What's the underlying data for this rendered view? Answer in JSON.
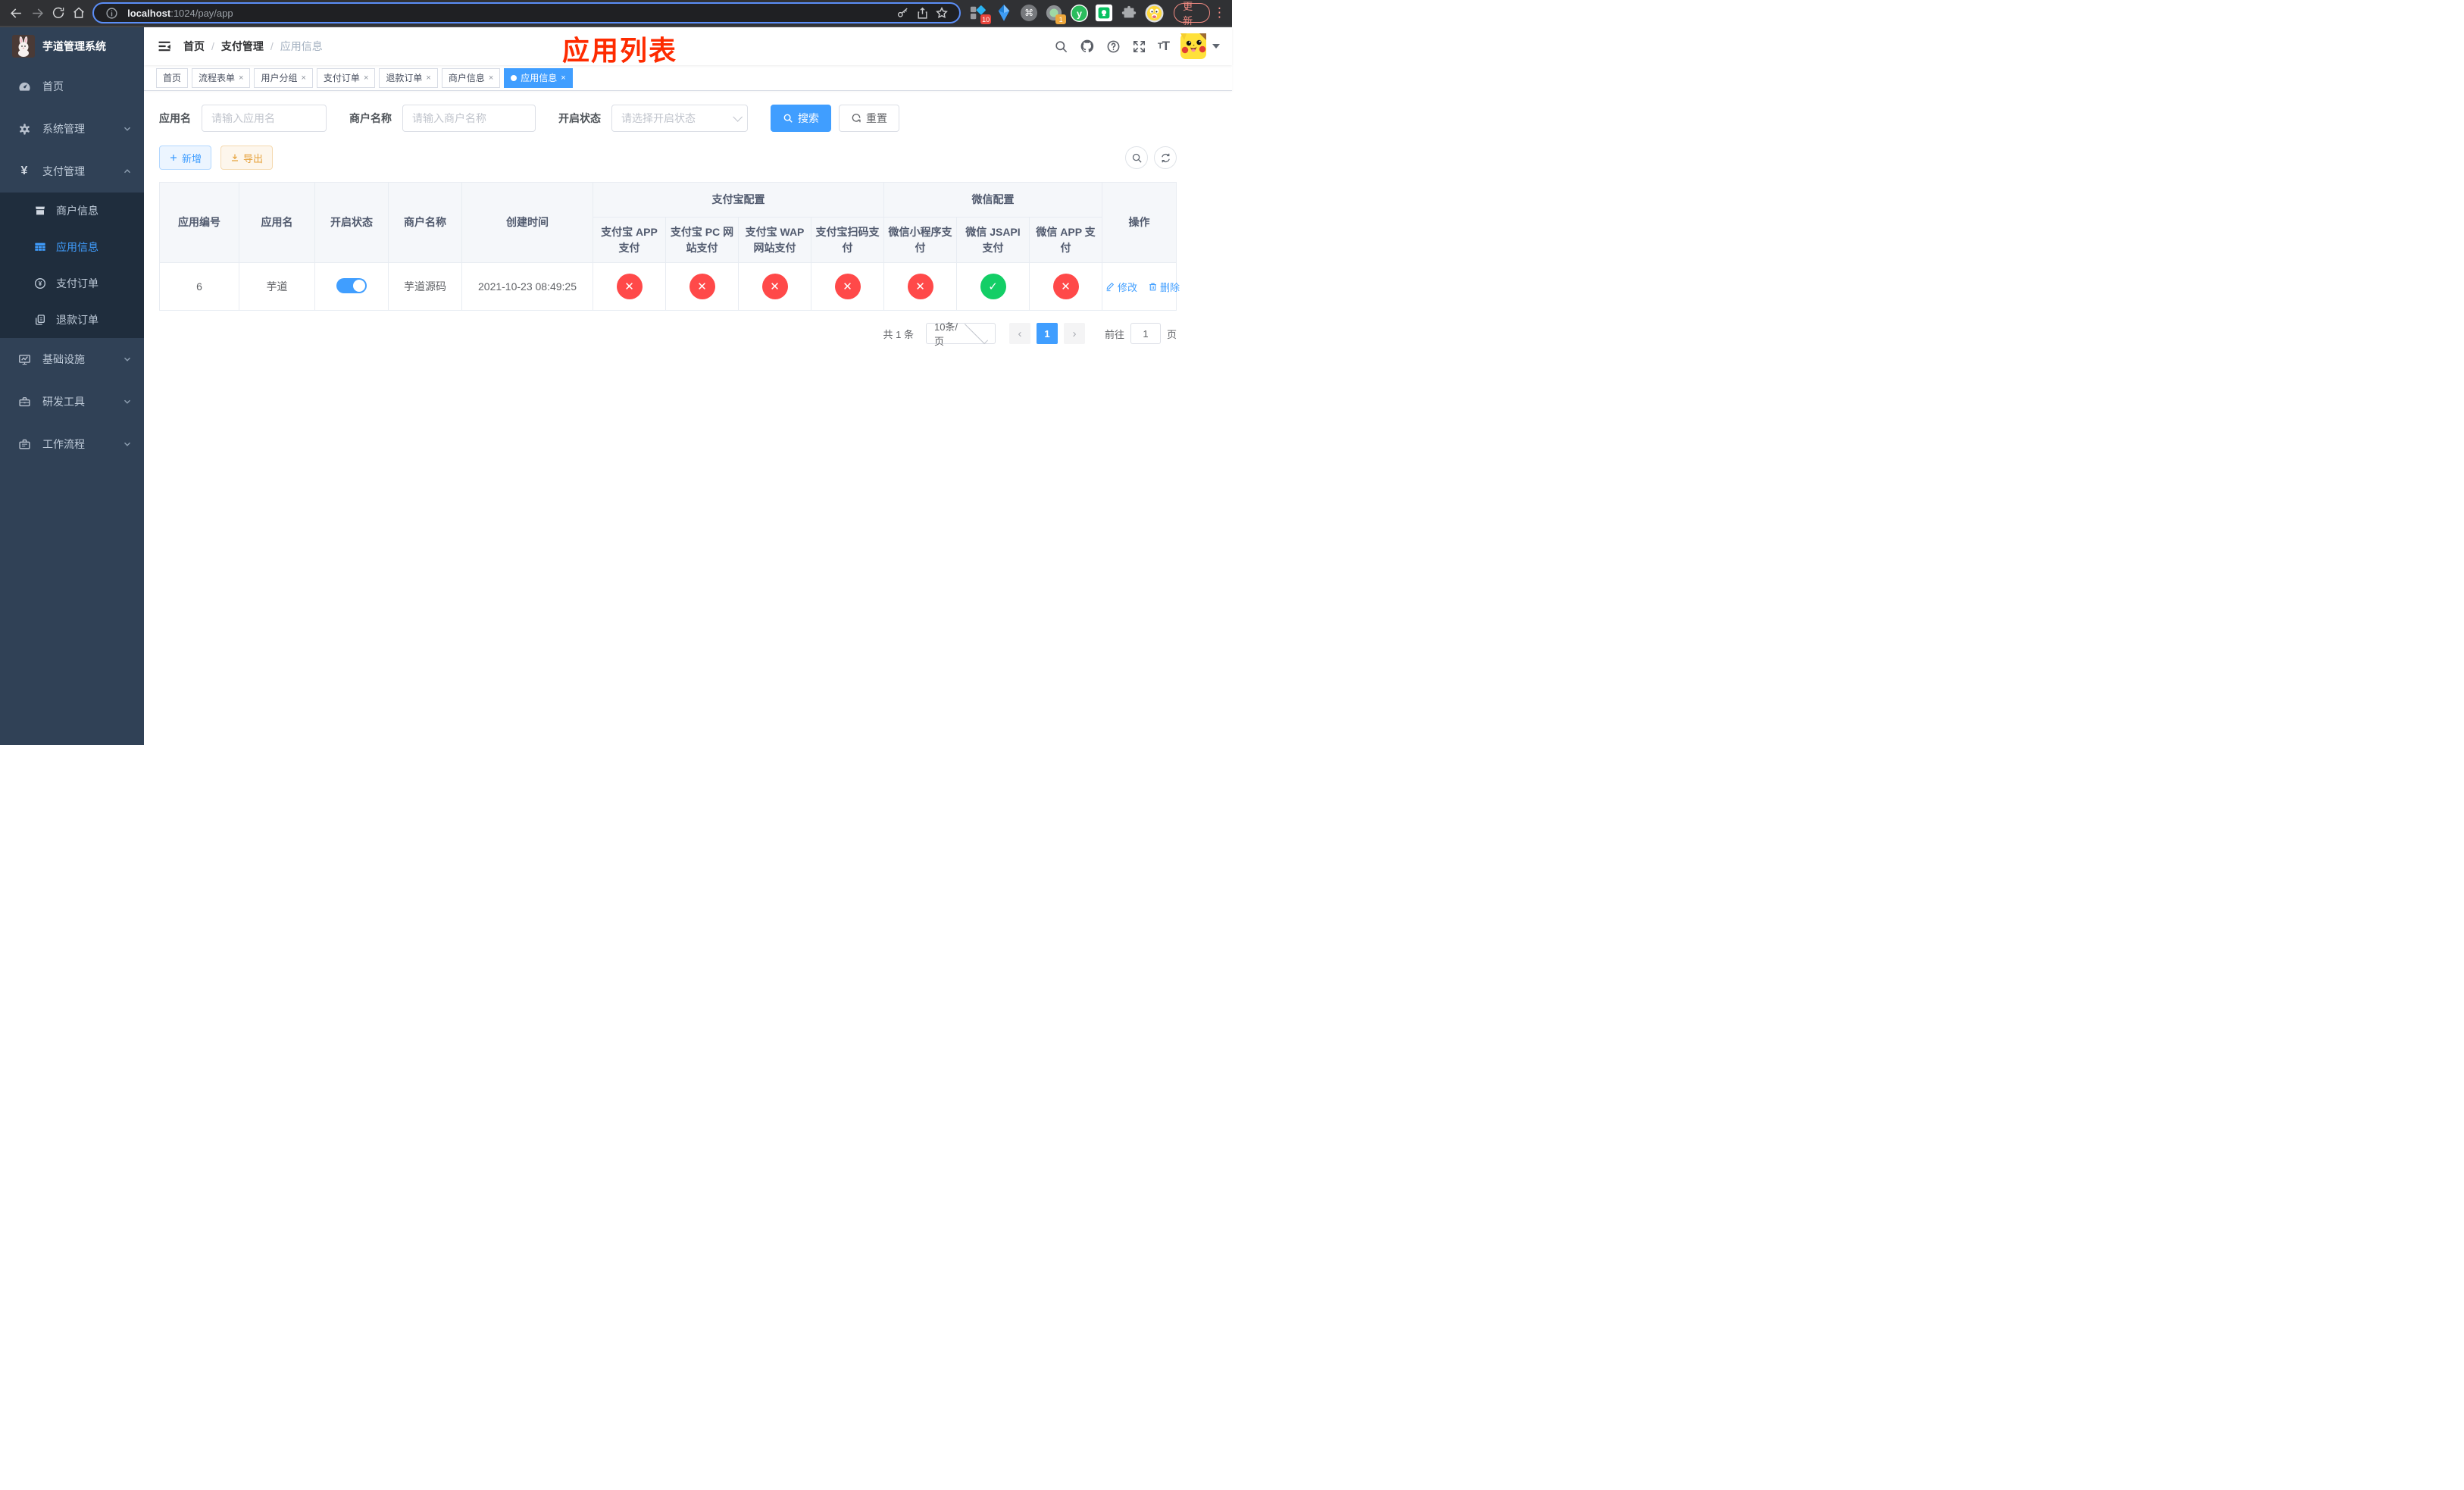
{
  "colors": {
    "accent": "#409eff",
    "success": "#13ce66",
    "danger": "#ff4949"
  },
  "icons": {
    "cmd": "⌘",
    "dots": "⋮",
    "check": "✓",
    "cross": "✕",
    "question": "?",
    "tt_small": "T",
    "tt_big": "T"
  },
  "browser": {
    "url_host": "localhost",
    "url_rest": ":1024/pay/app",
    "update_label": "更新",
    "ext_badge_blue": "10",
    "ext_badge_gray": "1"
  },
  "sidebar": {
    "title": "芋道管理系统",
    "menu": [
      {
        "label": "首页"
      },
      {
        "label": "系统管理"
      },
      {
        "label": "支付管理"
      },
      {
        "label": "基础设施"
      },
      {
        "label": "研发工具"
      },
      {
        "label": "工作流程"
      }
    ],
    "submenu": [
      {
        "label": "商户信息"
      },
      {
        "label": "应用信息"
      },
      {
        "label": "支付订单"
      },
      {
        "label": "退款订单"
      }
    ]
  },
  "navbar": {
    "breadcrumb": [
      "首页",
      "支付管理",
      "应用信息"
    ],
    "separator": "/"
  },
  "annotation": "应用列表",
  "tags": [
    {
      "label": "首页",
      "closable": false,
      "active": false
    },
    {
      "label": "流程表单",
      "closable": true,
      "active": false
    },
    {
      "label": "用户分组",
      "closable": true,
      "active": false
    },
    {
      "label": "支付订单",
      "closable": true,
      "active": false
    },
    {
      "label": "退款订单",
      "closable": true,
      "active": false
    },
    {
      "label": "商户信息",
      "closable": true,
      "active": false
    },
    {
      "label": "应用信息",
      "closable": true,
      "active": true
    }
  ],
  "close_glyph": "×",
  "filters": {
    "app_name": {
      "label": "应用名",
      "placeholder": "请输入应用名"
    },
    "merchant_name": {
      "label": "商户名称",
      "placeholder": "请输入商户名称"
    },
    "status": {
      "label": "开启状态",
      "placeholder": "请选择开启状态"
    },
    "search": "搜索",
    "reset": "重置"
  },
  "toolbar": {
    "add": "新增",
    "export": "导出"
  },
  "table": {
    "simple_columns": [
      "应用编号",
      "应用名",
      "开启状态",
      "商户名称",
      "创建时间"
    ],
    "groups": [
      {
        "label": "支付宝配置",
        "span": 4
      },
      {
        "label": "微信配置",
        "span": 3
      }
    ],
    "sub_columns": [
      "支付宝 APP 支付",
      "支付宝 PC 网站支付",
      "支付宝 WAP 网站支付",
      "支付宝扫码支付",
      "微信小程序支付",
      "微信 JSAPI 支付",
      "微信 APP 支付"
    ],
    "ops_column": "操作",
    "rows": [
      {
        "id": "6",
        "name": "芋道",
        "enabled": true,
        "merchant": "芋道源码",
        "created": "2021-10-23 08:49:25",
        "statuses": [
          "no",
          "no",
          "no",
          "no",
          "no",
          "yes",
          "no"
        ],
        "edit": "修改",
        "delete": "删除"
      }
    ]
  },
  "pagination": {
    "total": "共 1 条",
    "page_size": "10条/页",
    "prev": "‹",
    "page": "1",
    "next": "›",
    "goto": "前往",
    "goto_value": "1",
    "unit": "页"
  }
}
